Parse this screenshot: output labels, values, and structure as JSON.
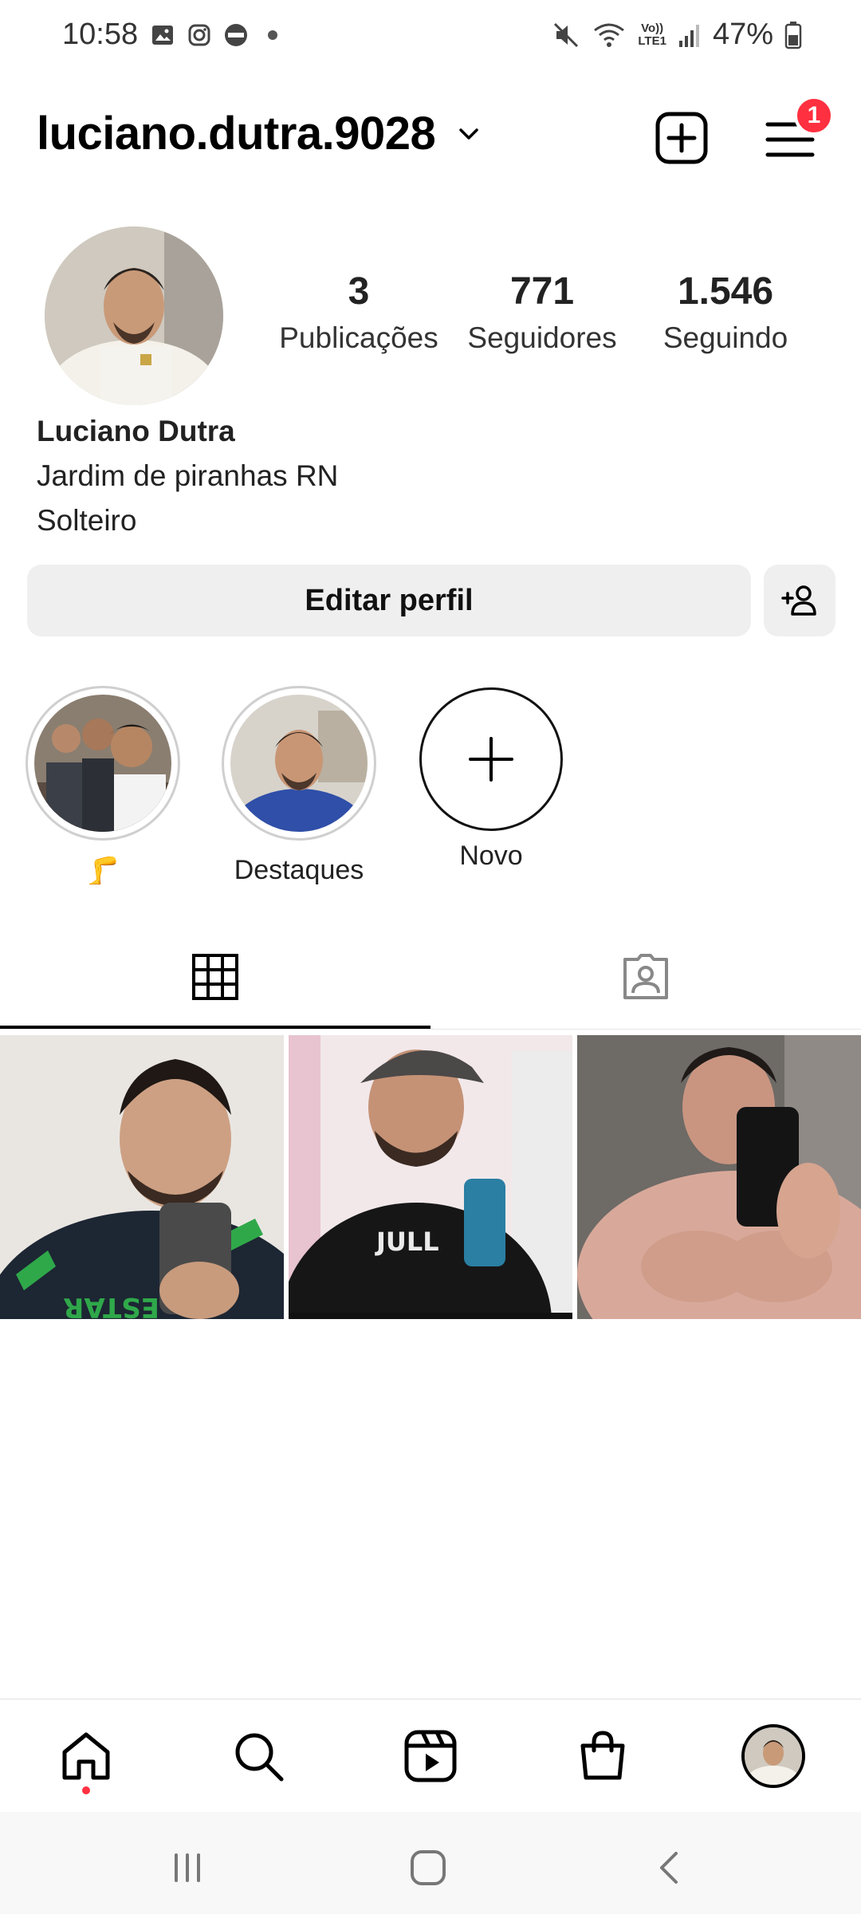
{
  "status_bar": {
    "time": "10:58",
    "lte_top": "Vo))",
    "lte_bottom": "LTE1",
    "battery": "47%"
  },
  "header": {
    "username": "luciano.dutra.9028",
    "menu_badge": "1"
  },
  "profile": {
    "stats": [
      {
        "value": "3",
        "label": "Publicações"
      },
      {
        "value": "771",
        "label": "Seguidores"
      },
      {
        "value": "1.546",
        "label": "Seguindo"
      }
    ],
    "name": "Luciano Dutra",
    "bio_lines": [
      "Jardim de piranhas RN",
      "Solteiro"
    ],
    "edit_label": "Editar perfil"
  },
  "highlights": [
    {
      "label": "🦵"
    },
    {
      "label": "Destaques"
    },
    {
      "label": "Novo"
    }
  ],
  "tabs": [
    {
      "icon": "grid-icon",
      "active": true
    },
    {
      "icon": "tagged-icon",
      "active": false
    }
  ],
  "posts_count": 3,
  "bottom_nav": [
    "home-icon",
    "search-icon",
    "reels-icon",
    "shop-icon",
    "profile-avatar"
  ],
  "colors": {
    "badge": "#ff3040",
    "button_bg": "#efefef"
  }
}
